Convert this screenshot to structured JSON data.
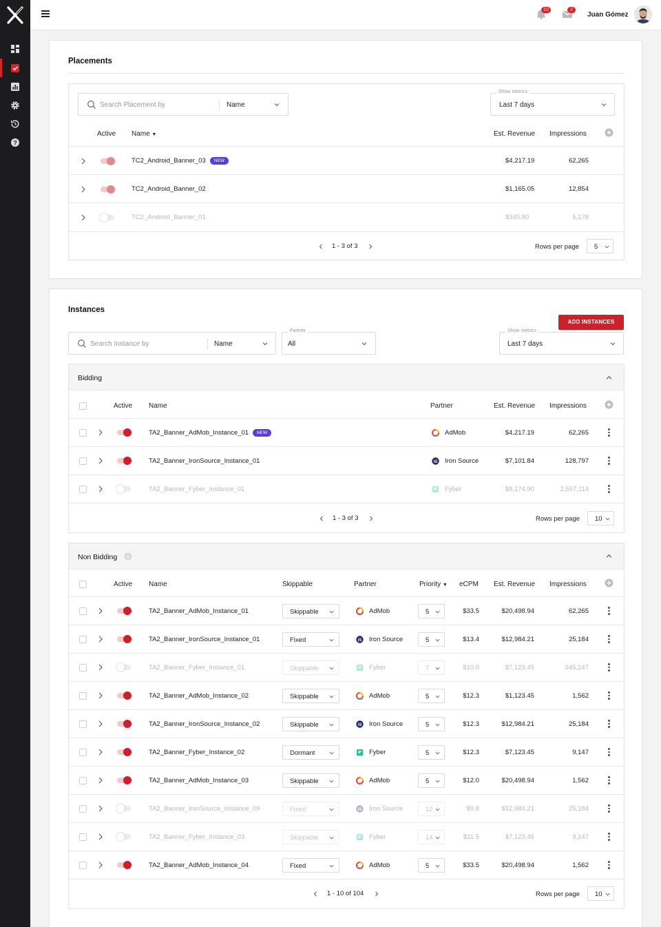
{
  "header": {
    "user_name": "Juan Gómez",
    "notifications_count": "10",
    "messages_count": "2"
  },
  "placements": {
    "title": "Placements",
    "search_placeholder": "Search Placement by",
    "search_by": "Name",
    "metrics_label": "Show metrics",
    "metrics_value": "Last 7 days",
    "columns": {
      "active": "Active",
      "name": "Name",
      "revenue": "Est. Revenue",
      "impressions": "Impressions"
    },
    "rows": [
      {
        "name": "TC2_Android_Banner_03",
        "badge": "NEW",
        "revenue": "$4,217.19",
        "impressions": "62,265"
      },
      {
        "name": "TC2_Android_Banner_02",
        "badge": "",
        "revenue": "$1,165.05",
        "impressions": "12,854"
      },
      {
        "name": "TC2_Android_Banner_01",
        "badge": "",
        "revenue": "$345.80",
        "impressions": "5,178"
      }
    ],
    "pagination": "1 - 3 of 3",
    "rows_per_page_label": "Rows per page",
    "rows_per_page": "5"
  },
  "instances": {
    "title": "Instances",
    "add_button": "ADD INSTANCES",
    "search_placeholder": "Search Instance by",
    "search_by": "Name",
    "partner_label": "Partner",
    "partner_value": "All",
    "metrics_label": "Show metrics",
    "metrics_value": "Last 7 days",
    "bidding": {
      "title": "Bidding",
      "columns": {
        "active": "Active",
        "name": "Name",
        "partner": "Partner",
        "revenue": "Est. Revenue",
        "impressions": "Impressions"
      },
      "rows": [
        {
          "name": "TA2_Banner_AdMob_Instance_01",
          "badge": "NEW",
          "partner": "AdMob",
          "revenue": "$4,217.19",
          "impressions": "62,265"
        },
        {
          "name": "TA2_Banner_IronSource_Instance_01",
          "badge": "",
          "partner": "Iron Source",
          "revenue": "$7,101.84",
          "impressions": "128,797"
        },
        {
          "name": "TA2_Banner_Fyber_Instance_01",
          "badge": "",
          "partner": "Fyber",
          "revenue": "$9,174.90",
          "impressions": "2,557,114"
        }
      ],
      "pagination": "1 - 3 of 3",
      "rows_per_page_label": "Rows per page",
      "rows_per_page": "10"
    },
    "non_bidding": {
      "title": "Non Bidding",
      "columns": {
        "active": "Active",
        "name": "Name",
        "skippable": "Skippable",
        "partner": "Partner",
        "priority": "Priority",
        "ecpm": "eCPM",
        "revenue": "Est. Revenue",
        "impressions": "Impressions"
      },
      "rows": [
        {
          "name": "TA2_Banner_AdMob_Instance_01",
          "skip": "Skippable",
          "partner": "AdMob",
          "priority": "5",
          "ecpm": "$33.5",
          "revenue": "$20,498.94",
          "impressions": "62,265"
        },
        {
          "name": "TA2_Banner_IronSource_Instance_01",
          "skip": "Fixed",
          "partner": "Iron Source",
          "priority": "5",
          "ecpm": "$13.4",
          "revenue": "$12,984.21",
          "impressions": "25,184"
        },
        {
          "name": "TA2_Banner_Fyber_Instance_01",
          "skip": "Skippable",
          "partner": "Fyber",
          "priority": "7",
          "ecpm": "$10.0",
          "revenue": "$7,123.45",
          "impressions": "945,147"
        },
        {
          "name": "TA2_Banner_AdMob_Instance_02",
          "skip": "Skippable",
          "partner": "AdMob",
          "priority": "5",
          "ecpm": "$12.3",
          "revenue": "$1,123.45",
          "impressions": "1,562"
        },
        {
          "name": "TA2_Banner_IronSource_Instance_02",
          "skip": "Skippable",
          "partner": "Iron Source",
          "priority": "5",
          "ecpm": "$12.3",
          "revenue": "$12,984.21",
          "impressions": "25,184"
        },
        {
          "name": "TA2_Banner_Fyber_Instance_02",
          "skip": "Dormant",
          "partner": "Fyber",
          "priority": "5",
          "ecpm": "$12.3",
          "revenue": "$7,123.45",
          "impressions": "9,147"
        },
        {
          "name": "TA2_Banner_AdMob_Instance_03",
          "skip": "Skippable",
          "partner": "AdMob",
          "priority": "5",
          "ecpm": "$12.0",
          "revenue": "$20,498.94",
          "impressions": "1,562"
        },
        {
          "name": "TA2_Banner_IronSource_Instance_09",
          "skip": "Fixed",
          "partner": "Iron Source",
          "priority": "12",
          "ecpm": "$9.8",
          "revenue": "$12,984.21",
          "impressions": "25,184"
        },
        {
          "name": "TA2_Banner_Fyber_Instance_03",
          "skip": "Skippable",
          "partner": "Fyber",
          "priority": "14",
          "ecpm": "$11.5",
          "revenue": "$7,123.45",
          "impressions": "9,147"
        },
        {
          "name": "TA2_Banner_AdMob_Instance_04",
          "skip": "Fixed",
          "partner": "AdMob",
          "priority": "5",
          "ecpm": "$33.5",
          "revenue": "$20,498.94",
          "impressions": "1,562"
        }
      ],
      "pagination": "1 - 10 of 104",
      "rows_per_page_label": "Rows per page",
      "rows_per_page": "10"
    }
  },
  "colors": {
    "accent": "#d8232a",
    "new_badge": "#5b3fd4",
    "sidebar": "#1c1c1e"
  }
}
